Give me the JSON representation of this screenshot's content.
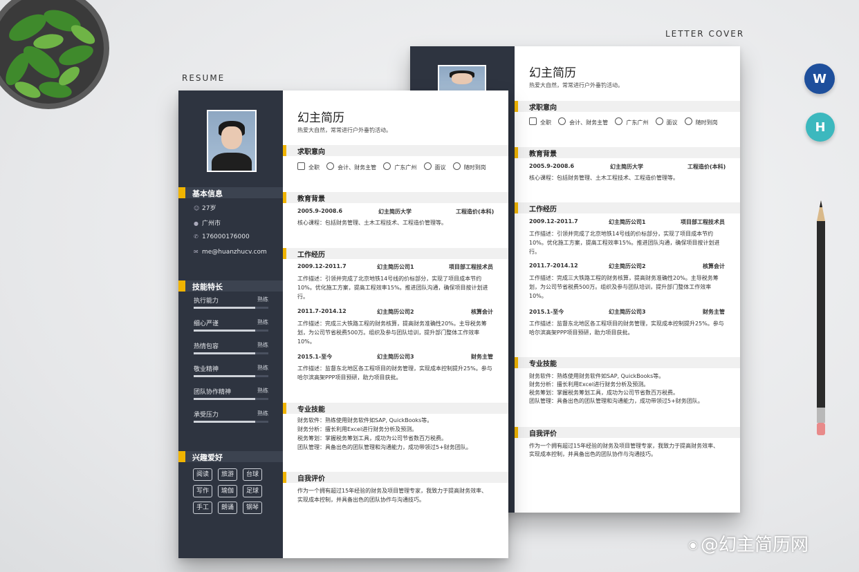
{
  "labels": {
    "resume": "RESUME",
    "cover": "LETTER COVER"
  },
  "watermark": "@幻主简历网",
  "front": {
    "name": "幻主简历",
    "motto": "热爱大自然，常常进行户外垂钓活动。",
    "basic": {
      "title": "基本信息",
      "items": [
        "27岁",
        "广州市",
        "176000176000",
        "me@huanzhucv.com"
      ]
    },
    "skills": {
      "title": "技能特长",
      "items": [
        {
          "name": "执行能力",
          "level": "熟练",
          "fill": 0.82
        },
        {
          "name": "细心严谨",
          "level": "熟练",
          "fill": 0.82
        },
        {
          "name": "热情包容",
          "level": "熟练",
          "fill": 0.82
        },
        {
          "name": "敬业精神",
          "level": "熟练",
          "fill": 0.82
        },
        {
          "name": "团队协作精神",
          "level": "熟练",
          "fill": 0.82
        },
        {
          "name": "承受压力",
          "level": "熟练",
          "fill": 0.82
        }
      ]
    },
    "hobbies": {
      "title": "兴趣爱好",
      "items": [
        "阅读",
        "旅游",
        "台球",
        "写作",
        "瑜伽",
        "足球",
        "手工",
        "朗诵",
        "钢琴"
      ]
    },
    "intent": {
      "title": "求职意向",
      "items": [
        "全职",
        "会计、财务主管",
        "广东广州",
        "面议",
        "随时到岗"
      ]
    },
    "edu": {
      "title": "教育背景",
      "period": "2005.9-2008.6",
      "school": "幻主简历大学",
      "major": "工程造价(本科)",
      "course": "核心课程：包括财务管理、土木工程技术、工程造价管理等。"
    },
    "work": {
      "title": "工作经历",
      "items": [
        {
          "period": "2009.12-2011.7",
          "company": "幻主简历公司1",
          "role": "项目部工程技术员",
          "desc": "工作描述：引领并完成了北京地铁14号线的价标部分，实现了项目成本节约10%。优化施工方案，提高工程效率15%。推进团队沟通，确保项目按计划进行。"
        },
        {
          "period": "2011.7-2014.12",
          "company": "幻主简历公司2",
          "role": "核算会计",
          "desc": "工作描述：完成三大铁路工程的财务核算，提高财务准确性20%。主导税务筹划，为公司节省税费500万。组织及参与团队培训，提升部门整体工作效率10%。"
        },
        {
          "period": "2015.1-至今",
          "company": "幻主简历公司3",
          "role": "财务主管",
          "desc": "工作描述：监督东北地区各工程项目的财务管理，实现成本控制提升25%。参与哈尔滨高架PPP项目预研，助力项目获批。"
        }
      ]
    },
    "pro": {
      "title": "专业技能",
      "items": [
        "财务软件：熟练使用财务软件如SAP, QuickBooks等。",
        "财务分析：擅长利用Excel进行财务分析及预测。",
        "税务筹划：掌握税务筹划工具，成功为公司节省数百万税费。",
        "团队管理：具备出色的团队管理和沟通能力，成功带领过5+财务团队。"
      ]
    },
    "self": {
      "title": "自我评价",
      "lines": [
        "作为一个拥有超过15年经验的财务及项目管理专家，我致力于提高财务效率、",
        "实现成本控制，并具备出色的团队协作与沟通技巧。"
      ]
    }
  },
  "back": {
    "name": "幻主简历",
    "motto": "热爱大自然，常常进行户外垂钓活动。",
    "intent": {
      "title": "求职意向",
      "items": [
        "全职",
        "会计、财务主管",
        "广东广州",
        "面议",
        "随时到岗"
      ]
    },
    "edu": {
      "title": "教育背景",
      "period": "2005.9-2008.6",
      "school": "幻主简历大学",
      "major": "工程造价(本科)",
      "course": "核心课程：包括财务管理、土木工程技术、工程造价管理等。"
    },
    "work": {
      "title": "工作经历",
      "items": [
        {
          "period": "2009.12-2011.7",
          "company": "幻主简历公司1",
          "role": "项目部工程技术员",
          "desc": "工作描述：引领并完成了北京地铁14号线的价标部分，实现了项目成本节约10%。优化施工方案，提高工程效率15%。推进团队沟通，确保项目按计划进行。"
        },
        {
          "period": "2011.7-2014.12",
          "company": "幻主简历公司2",
          "role": "核算会计",
          "desc": "工作描述：完成三大铁路工程的财务核算，提高财务准确性20%。主导税务筹划，为公司节省税费500万。组织及参与团队培训，提升部门整体工作效率10%。"
        },
        {
          "period": "2015.1-至今",
          "company": "幻主简历公司3",
          "role": "财务主管",
          "desc": "工作描述：监督东北地区各工程项目的财务管理，实现成本控制提升25%。参与哈尔滨高架PPP项目预研，助力项目获批。"
        }
      ]
    },
    "pro": {
      "title": "专业技能",
      "items": [
        "财务软件：熟练使用财务软件如SAP, QuickBooks等。",
        "财务分析：擅长利用Excel进行财务分析及预测。",
        "税务筹划：掌握税务筹划工具，成功为公司节省数百万税费。",
        "团队管理：具备出色的团队管理和沟通能力，成功带领过5+财务团队。"
      ]
    },
    "self": {
      "title": "自我评价",
      "lines": [
        "作为一个拥有超过15年经验的财务及项目管理专家，我致力于提高财务效率、",
        "实现成本控制，并具备出色的团队协作与沟通技巧。"
      ]
    }
  },
  "apps": [
    {
      "name": "word-app-icon",
      "glyph": "W",
      "color": "#1e4f9c"
    },
    {
      "name": "wps-app-icon",
      "glyph": "H",
      "color": "#3cb8be"
    }
  ]
}
